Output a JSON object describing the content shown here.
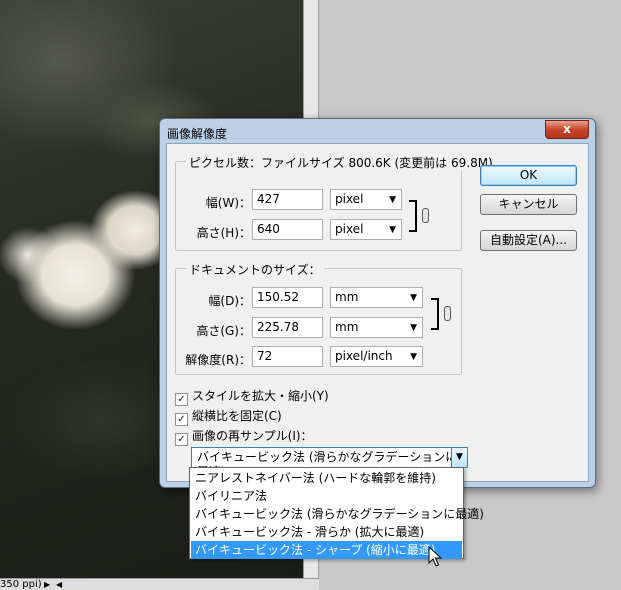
{
  "status_bar": {
    "zoom_text": "350 ppi)"
  },
  "dialog": {
    "title": "画像解像度",
    "close_label": "x",
    "pixel_dimensions": {
      "title": "ピクセル数：ファイルサイズ 800.6K (変更前は 69.8M)",
      "width_label": "幅(W)：",
      "width_value": "427",
      "width_unit": "pixel",
      "height_label": "高さ(H)：",
      "height_value": "640",
      "height_unit": "pixel"
    },
    "document_size": {
      "title": "ドキュメントのサイズ：",
      "width_label": "幅(D)：",
      "width_value": "150.52",
      "width_unit": "mm",
      "height_label": "高さ(G)：",
      "height_value": "225.78",
      "height_unit": "mm",
      "resolution_label": "解像度(R)：",
      "resolution_value": "72",
      "resolution_unit": "pixel/inch"
    },
    "buttons": {
      "ok": "OK",
      "cancel": "キャンセル",
      "auto": "自動設定(A)..."
    },
    "checkboxes": {
      "scale_styles": "スタイルを拡大・縮小(Y)",
      "constrain": "縦横比を固定(C)",
      "resample": "画像の再サンプル(I)："
    },
    "check_mark": "✓",
    "resample_method": "バイキュービック法 (滑らかなグラデーションに最適)"
  },
  "dropdown": {
    "options": [
      "ニアレストネイバー法 (ハードな輪郭を維持)",
      "バイリニア法",
      "バイキュービック法 (滑らかなグラデーションに最適)",
      "バイキュービック法 - 滑らか (拡大に最適)",
      "バイキュービック法 - シャープ (縮小に最適)"
    ],
    "selected_index": 4
  }
}
